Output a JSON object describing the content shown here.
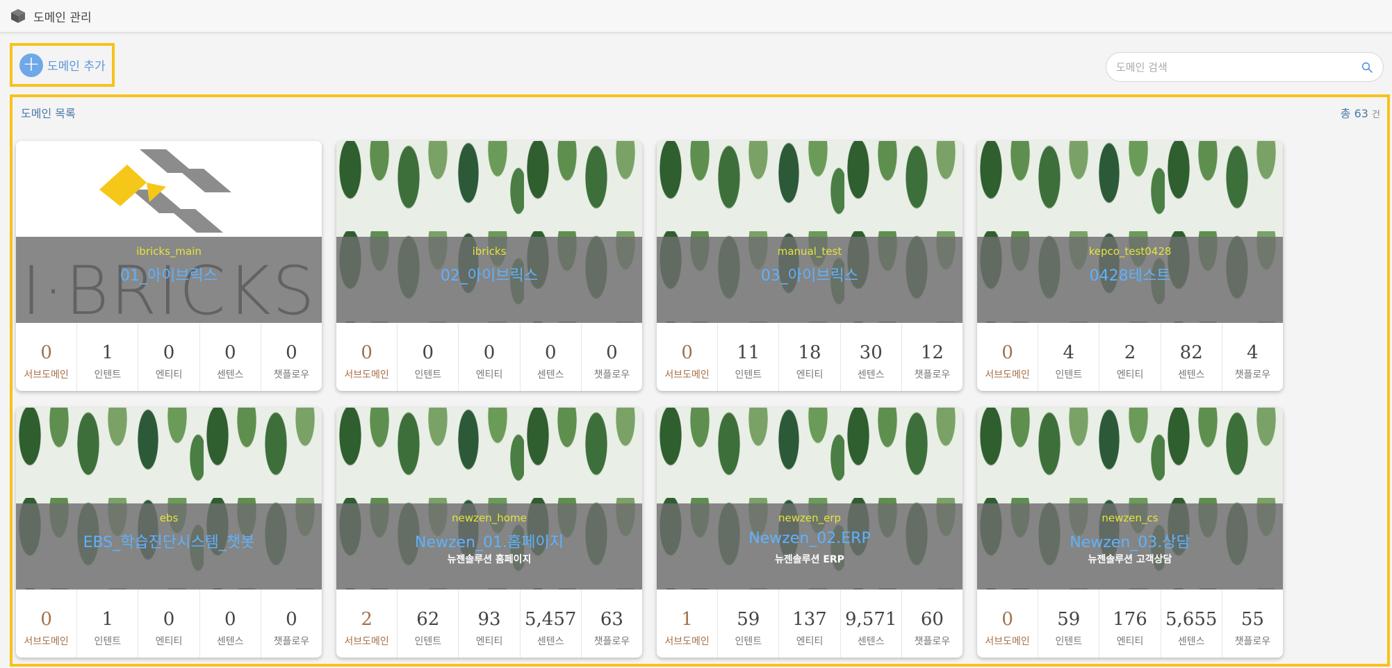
{
  "header": {
    "title": "도메인 관리",
    "icon": "cube-icon"
  },
  "toolbar": {
    "add_label": "도메인 추가",
    "add_icon": "plus-circle-icon"
  },
  "search": {
    "placeholder": "도메인 검색",
    "icon": "search-icon"
  },
  "list": {
    "title": "도메인 목록",
    "total_prefix": "총",
    "total_count": "63",
    "total_unit": "건"
  },
  "stat_labels": [
    "서브도메인",
    "인텐트",
    "엔티티",
    "센텐스",
    "챗플로우"
  ],
  "colors": {
    "accent": "#f7c21b",
    "link": "#5b95da",
    "domain_id": "#e5e53a",
    "domain_name": "#5fb2ff",
    "subdomain": "#a3704a"
  },
  "cards": [
    {
      "id": "ibricks_main",
      "name": "01_아이브릭스",
      "desc": "",
      "image": "ibricks-logo",
      "logo_text": "I·BRICKS",
      "stats": [
        "0",
        "1",
        "0",
        "0",
        "0"
      ]
    },
    {
      "id": "ibricks",
      "name": "02_아이브릭스",
      "desc": "",
      "image": "leaves",
      "stats": [
        "0",
        "0",
        "0",
        "0",
        "0"
      ]
    },
    {
      "id": "manual_test",
      "name": "03_아이브릭스",
      "desc": "",
      "image": "leaves",
      "stats": [
        "0",
        "11",
        "18",
        "30",
        "12"
      ]
    },
    {
      "id": "kepco_test0428",
      "name": "0428테스트",
      "desc": "",
      "image": "leaves",
      "stats": [
        "0",
        "4",
        "2",
        "82",
        "4"
      ]
    },
    {
      "id": "ebs",
      "name": "EBS_학습진단시스템_챗봇",
      "desc": "",
      "image": "leaves",
      "stats": [
        "0",
        "1",
        "0",
        "0",
        "0"
      ]
    },
    {
      "id": "newzen_home",
      "name": "Newzen_01.홈페이지",
      "desc": "뉴젠솔루션 홈페이지",
      "image": "leaves",
      "stats": [
        "2",
        "62",
        "93",
        "5,457",
        "63"
      ]
    },
    {
      "id": "newzen_erp",
      "name": "Newzen_02.ERP",
      "desc": "뉴젠솔루션 ERP",
      "image": "leaves",
      "stats": [
        "1",
        "59",
        "137",
        "9,571",
        "60"
      ]
    },
    {
      "id": "newzen_cs",
      "name": "Newzen_03.상담",
      "desc": "뉴젠솔루션 고객상담",
      "image": "leaves",
      "stats": [
        "0",
        "59",
        "176",
        "5,655",
        "55"
      ]
    }
  ]
}
